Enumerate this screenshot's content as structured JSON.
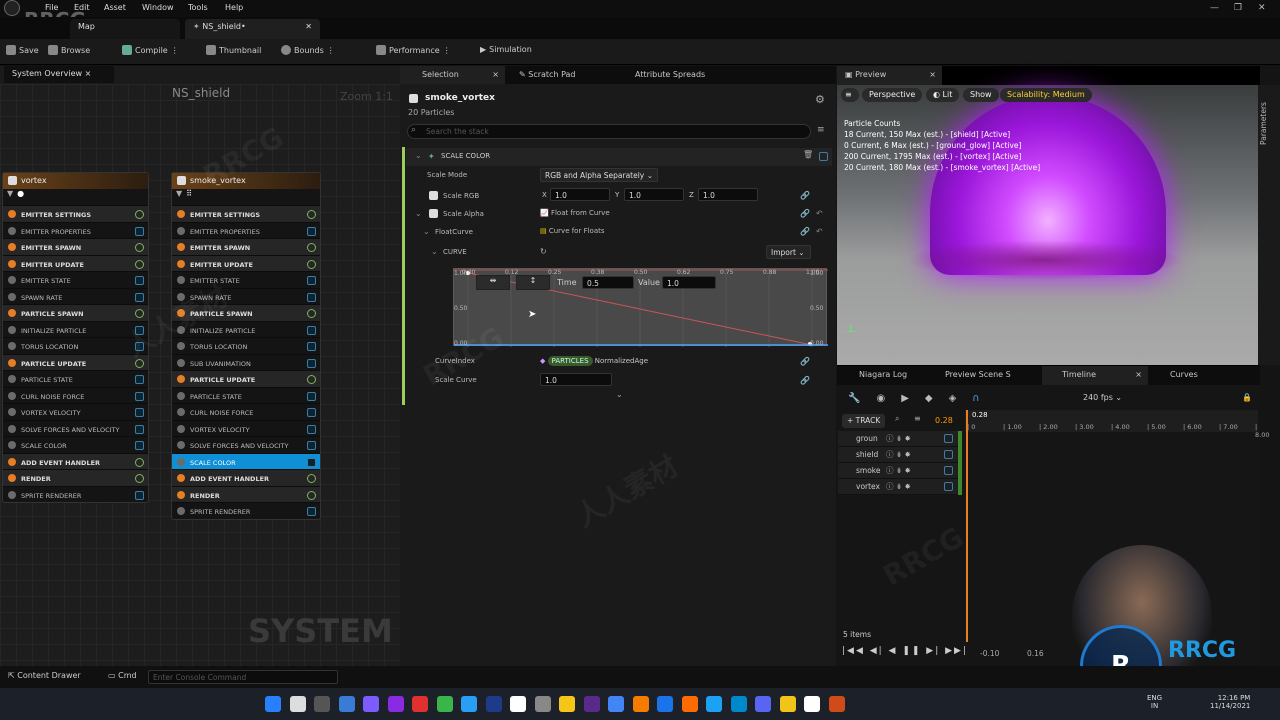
{
  "menubar": {
    "items": [
      "File",
      "Edit",
      "Asset",
      "Window",
      "Tools",
      "Help"
    ],
    "logo_text": "RRCG"
  },
  "tabs": {
    "map": "Map",
    "asset": "NS_shield•"
  },
  "toolbar": {
    "save": "Save",
    "browse": "Browse",
    "compile": "Compile",
    "thumbnail": "Thumbnail",
    "bounds": "Bounds",
    "performance": "Performance",
    "simulation": "Simulation"
  },
  "system_overview": {
    "tab": "System Overview ×",
    "title": "NS_shield",
    "zoom": "Zoom 1:1",
    "system_label": "SYSTEM",
    "vortex": {
      "name": "vortex",
      "rows": [
        {
          "label": "EMITTER SETTINGS",
          "group": true
        },
        {
          "label": "EMITTER PROPERTIES"
        },
        {
          "label": "EMITTER SPAWN",
          "group": true
        },
        {
          "label": "EMITTER UPDATE",
          "group": true
        },
        {
          "label": "EMITTER STATE"
        },
        {
          "label": "SPAWN RATE"
        },
        {
          "label": "PARTICLE SPAWN",
          "group": true
        },
        {
          "label": "INITIALIZE PARTICLE"
        },
        {
          "label": "TORUS LOCATION"
        },
        {
          "label": "PARTICLE UPDATE",
          "group": true
        },
        {
          "label": "PARTICLE STATE"
        },
        {
          "label": "CURL NOISE FORCE"
        },
        {
          "label": "VORTEX VELOCITY"
        },
        {
          "label": "SOLVE FORCES AND VELOCITY"
        },
        {
          "label": "SCALE COLOR"
        },
        {
          "label": "ADD EVENT HANDLER",
          "group": true
        },
        {
          "label": "RENDER",
          "group": true
        },
        {
          "label": "SPRITE RENDERER"
        }
      ]
    },
    "smoke_vortex": {
      "name": "smoke_vortex",
      "rows": [
        {
          "label": "EMITTER SETTINGS",
          "group": true
        },
        {
          "label": "EMITTER PROPERTIES"
        },
        {
          "label": "EMITTER SPAWN",
          "group": true
        },
        {
          "label": "EMITTER UPDATE",
          "group": true
        },
        {
          "label": "EMITTER STATE"
        },
        {
          "label": "SPAWN RATE"
        },
        {
          "label": "PARTICLE SPAWN",
          "group": true
        },
        {
          "label": "INITIALIZE PARTICLE"
        },
        {
          "label": "TORUS LOCATION"
        },
        {
          "label": "SUB UVANIMATION"
        },
        {
          "label": "PARTICLE UPDATE",
          "group": true
        },
        {
          "label": "PARTICLE STATE"
        },
        {
          "label": "CURL NOISE FORCE"
        },
        {
          "label": "VORTEX VELOCITY"
        },
        {
          "label": "SOLVE FORCES AND VELOCITY"
        },
        {
          "label": "SCALE COLOR",
          "selected": true
        },
        {
          "label": "ADD EVENT HANDLER",
          "group": true
        },
        {
          "label": "RENDER",
          "group": true
        },
        {
          "label": "SPRITE RENDERER"
        }
      ]
    }
  },
  "selection": {
    "tabs": [
      "Selection",
      "Scratch Pad",
      "Attribute Spreads"
    ],
    "emitter": "smoke_vortex",
    "particles": "20 Particles",
    "search_placeholder": "Search the stack",
    "module": "SCALE COLOR",
    "scale_mode_label": "Scale Mode",
    "scale_mode": "RGB and Alpha Separately",
    "scale_rgb_label": "Scale RGB",
    "x": "1.0",
    "y": "1.0",
    "z": "1.0",
    "scale_alpha_label": "Scale Alpha",
    "scale_alpha": "Float from Curve",
    "float_curve_label": "FloatCurve",
    "float_curve": "Curve for Floats",
    "curve_label": "CURVE",
    "import": "Import",
    "time_label": "Time",
    "time": "0.5",
    "value_label": "Value",
    "value": "1.0",
    "curve_ticks_x": [
      "0.00",
      "0.12",
      "0.25",
      "0.38",
      "0.50",
      "0.62",
      "0.75",
      "0.88",
      "1.00"
    ],
    "curve_ticks_y": [
      "1.00",
      "0.50",
      "0.00"
    ],
    "curve_index_label": "CurveIndex",
    "particles_badge": "PARTICLES",
    "normalized_age": "NormalizedAge",
    "scale_curve_label": "Scale Curve",
    "scale_curve": "1.0"
  },
  "preview": {
    "tab": "Preview",
    "perspective": "Perspective",
    "lit": "Lit",
    "show": "Show",
    "scalability": "Scalability: Medium",
    "parameters": "Parameters",
    "stats": [
      "Particle Counts",
      "18 Current, 150 Max (est.) - [shield] [Active]",
      "0 Current, 6 Max (est.) - [ground_glow] [Active]",
      "200 Current, 1795 Max (est.) - [vortex] [Active]",
      "20 Current, 180 Max (est.) - [smoke_vortex] [Active]"
    ]
  },
  "timeline": {
    "tabs": [
      "Niagara Log",
      "Preview Scene S",
      "Timeline",
      "Curves"
    ],
    "track": "TRACK",
    "time": "0.28",
    "fps": "240 fps",
    "playhead": "0.28",
    "ruler": [
      "0",
      "1.00",
      "2.00",
      "3.00",
      "4.00",
      "5.00",
      "6.00",
      "7.00",
      "8.00"
    ],
    "tracks": [
      "groun",
      "shield",
      "smoke",
      "vortex"
    ],
    "items": "5 items",
    "start": "-0.10",
    "end": "0.16"
  },
  "bottom": {
    "content_drawer": "Content Drawer",
    "cmd": "Cmd",
    "console_placeholder": "Enter Console Command"
  },
  "taskbar": {
    "lang": "ENG",
    "region": "IN",
    "clock": "12:16 PM",
    "date": "11/14/2021"
  },
  "watermarks": [
    "RRCG",
    "人人素材"
  ]
}
